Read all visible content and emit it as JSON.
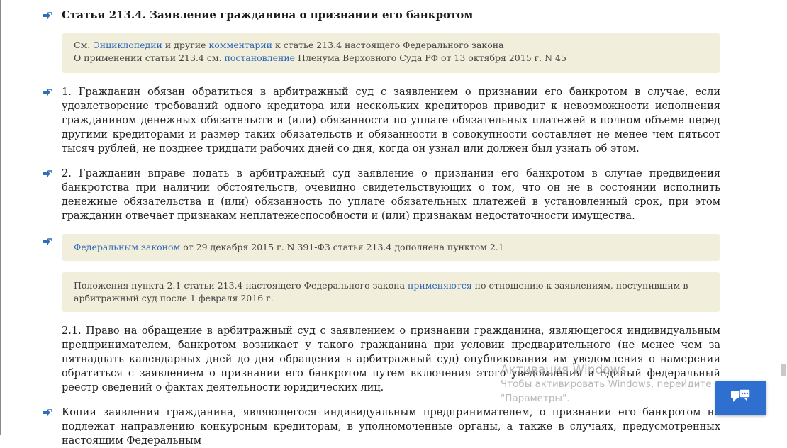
{
  "article": {
    "title": "Статья 213.4. Заявление гражданина о признании его банкротом"
  },
  "ref_note": {
    "line1_pre": "См. ",
    "line1_link1": "Энциклопедии",
    "line1_mid": " и другие ",
    "line1_link2": "комментарии",
    "line1_post": " к статье 213.4 настоящего Федерального закона",
    "line2_pre": "О применении статьи 213.4 см. ",
    "line2_link": "постановление",
    "line2_post": " Пленума Верховного Суда РФ от 13 октября 2015 г. N 45"
  },
  "paragraphs": {
    "p1": "1. Гражданин обязан обратиться в арбитражный суд с заявлением о признании его банкротом в случае, если удовлетворение требований одного кредитора или нескольких кредиторов приводит к невозможности исполнения гражданином денежных обязательств и (или) обязанности по уплате обязательных платежей в полном объеме перед другими кредиторами и размер таких обязательств и обязанности в совокупности составляет не менее чем пятьсот тысяч рублей, не позднее тридцати рабочих дней со дня, когда он узнал или должен был узнать об этом.",
    "p2": "2. Гражданин вправе подать в арбитражный суд заявление о признании его банкротом в случае предвидения банкротства при наличии обстоятельств, очевидно свидетельствующих о том, что он не в состоянии исполнить денежные обязательства и (или) обязанность по уплате обязательных платежей в установленный срок, при этом гражданин отвечает признакам неплатежеспособности и (или) признакам недостаточности имущества.",
    "p21": "2.1. Право на обращение в арбитражный суд с заявлением о признании гражданина, являющегося индивидуальным предпринимателем, банкротом возникает у такого гражданина при условии предварительного (не менее чем за пятнадцать календарных дней до дня обращения в арбитражный суд) опубликования им уведомления о намерении обратиться с заявлением о признании его банкротом путем включения этого уведомления в Единый федеральный реестр сведений о фактах деятельности юридических лиц.",
    "p_last": "Копии заявления гражданина, являющегося индивидуальным предпринимателем, о признании его банкротом не подлежат направлению конкурсным кредиторам, в уполномоченные органы, а также в случаях, предусмотренных настоящим Федеральным"
  },
  "amend_note": {
    "link": "Федеральным законом",
    "text": " от 29 декабря 2015 г. N 391-ФЗ статья 213.4 дополнена пунктом 2.1"
  },
  "apply_note": {
    "pre": "Положения пункта 2.1 статьи 213.4 настоящего Федерального закона ",
    "link": "применяются",
    "post": " по отношению к заявлениям, поступившим в арбитражный суд после 1 февраля 2016 г."
  },
  "watermark": {
    "title": "Активация Windows",
    "line1": "Чтобы активировать Windows, перейдите в раздел",
    "line2": "\"Параметры\"."
  },
  "icons": {
    "para_marker": "share-arrow-icon",
    "chat": "chat-bubbles-icon"
  },
  "colors": {
    "link": "#2f66b3",
    "note_bg": "#f1eedb",
    "marker": "#2f6fb8",
    "chat_button": "#2f6fcf"
  }
}
